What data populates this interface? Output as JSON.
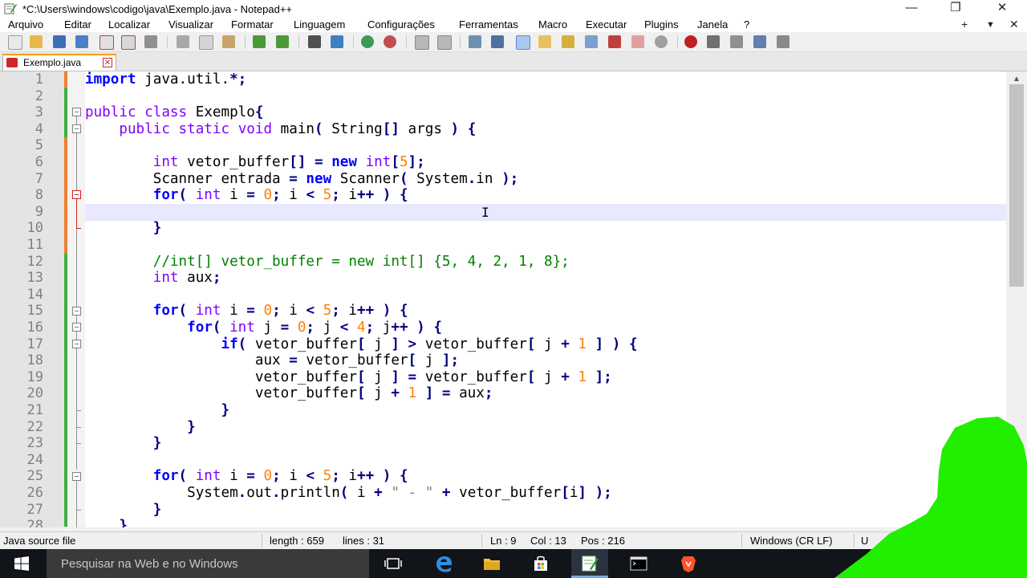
{
  "window": {
    "title": "*C:\\Users\\windows\\codigo\\java\\Exemplo.java - Notepad++",
    "minimize": "—",
    "restore": "❐",
    "close": "✕"
  },
  "menu": {
    "items": [
      "Arquivo",
      "Editar",
      "Localizar",
      "Visualizar",
      "Formatar",
      "Linguagem",
      "Configurações",
      "Ferramentas",
      "Macro",
      "Executar",
      "Plugins",
      "Janela",
      "?"
    ],
    "right_plus": "+",
    "right_arrow": "▼",
    "right_close": "✕"
  },
  "tab": {
    "label": "Exemplo.java",
    "close": "✕"
  },
  "editor": {
    "line_numbers": [
      "1",
      "2",
      "3",
      "4",
      "5",
      "6",
      "7",
      "8",
      "9",
      "10",
      "11",
      "12",
      "13",
      "14",
      "15",
      "16",
      "17",
      "18",
      "19",
      "20",
      "21",
      "22",
      "23",
      "24",
      "25",
      "26",
      "27",
      "28"
    ],
    "cursor_glyph": "I"
  },
  "status": {
    "file_type": "Java source file",
    "length": "length : 659",
    "lines": "lines : 31",
    "ln": "Ln : 9",
    "col": "Col : 13",
    "pos": "Pos : 216",
    "eol": "Windows (CR LF)",
    "encoding": "U"
  },
  "taskbar": {
    "search_placeholder": "Pesquisar na Web e no Windows"
  },
  "colors": {
    "keyword": "#0000ff",
    "type_keyword": "#8000ff",
    "number": "#ff8000",
    "comment": "#008000",
    "changed_marker_saved": "#3cb043",
    "changed_marker_unsaved": "#f08030",
    "current_line": "#e8e8ff",
    "overlay_green": "#22ee00"
  }
}
